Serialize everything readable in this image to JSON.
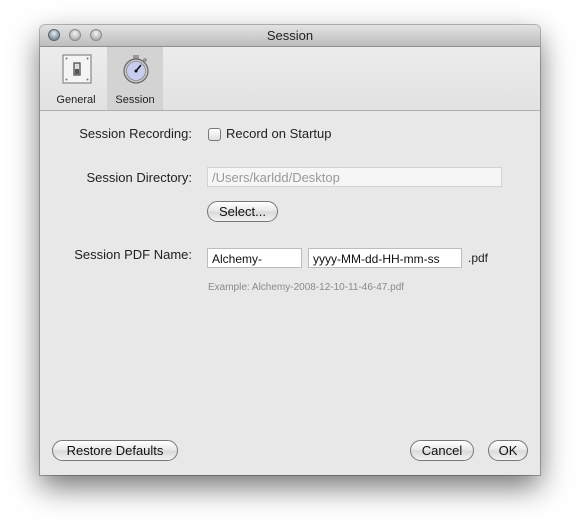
{
  "window": {
    "title": "Session"
  },
  "toolbar": {
    "tabs": [
      {
        "label": "General",
        "icon": "light-switch-icon",
        "selected": false
      },
      {
        "label": "Session",
        "icon": "stopwatch-icon",
        "selected": true
      }
    ]
  },
  "form": {
    "recording": {
      "label": "Session Recording:",
      "checkbox_label": "Record on Startup",
      "checked": false
    },
    "directory": {
      "label": "Session Directory:",
      "value": "/Users/karldd/Desktop",
      "select_button": "Select..."
    },
    "pdf_name": {
      "label": "Session PDF Name:",
      "prefix_value": "Alchemy-",
      "format_value": "yyyy-MM-dd-HH-mm-ss",
      "suffix": ".pdf",
      "example": "Example: Alchemy-2008-12-10-11-46-47.pdf"
    }
  },
  "buttons": {
    "restore_defaults": "Restore Defaults",
    "cancel": "Cancel",
    "ok": "OK"
  }
}
